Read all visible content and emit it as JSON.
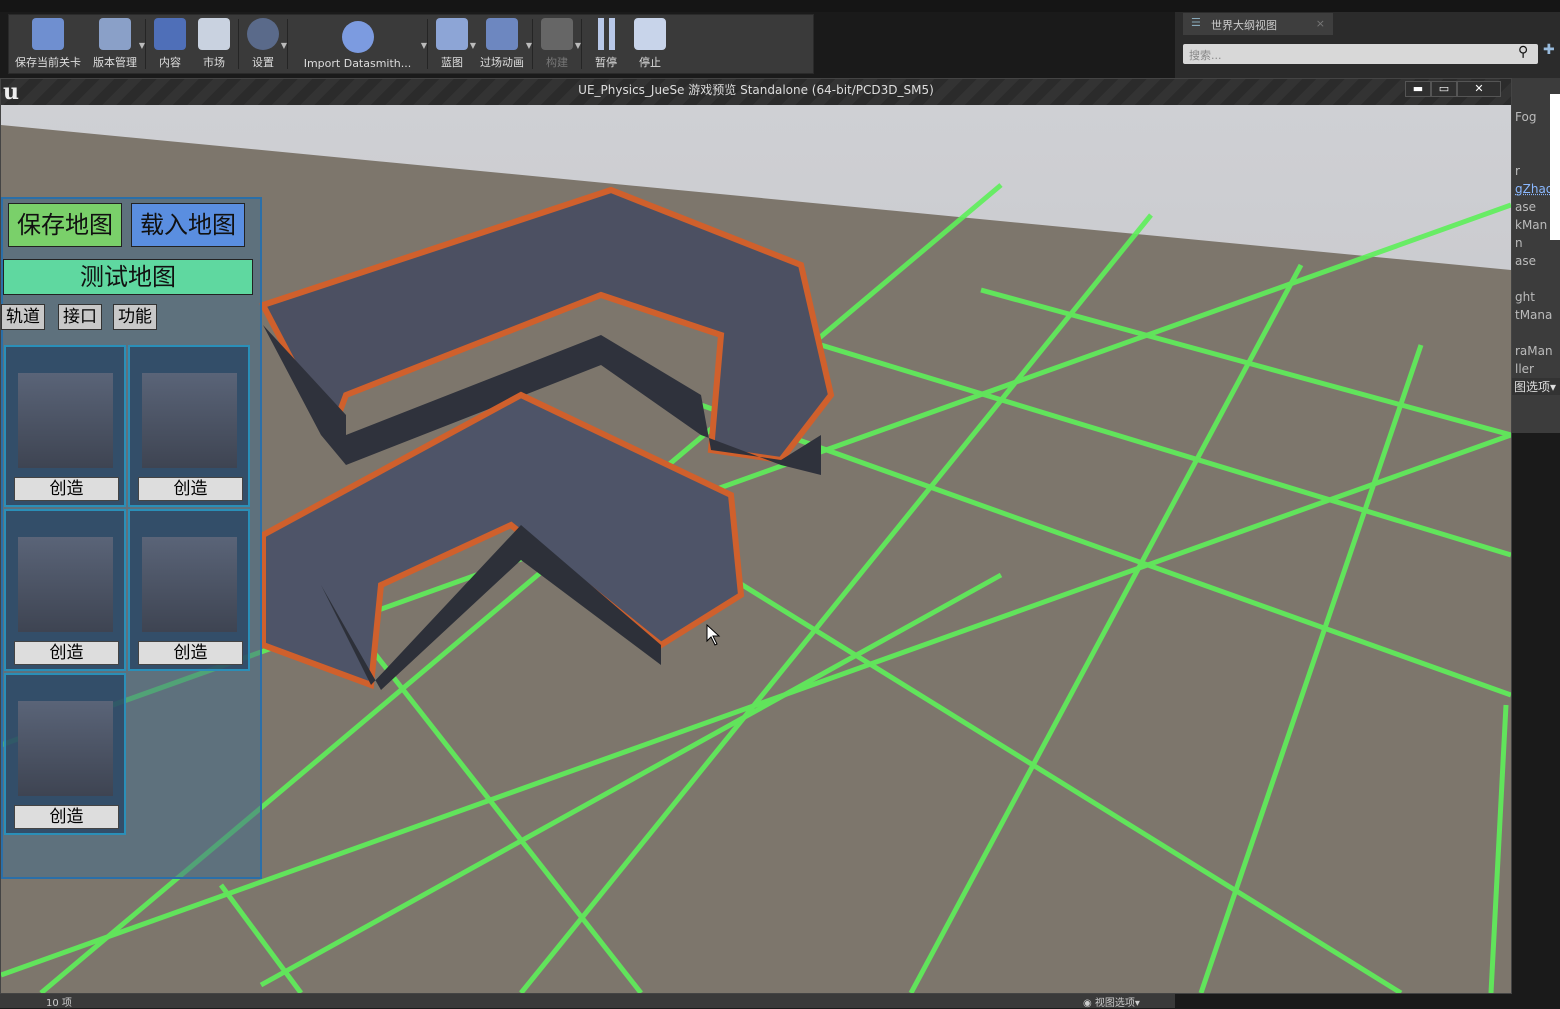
{
  "toolbar": {
    "items": [
      "保存当前关卡",
      "版本管理",
      "内容",
      "市场",
      "设置",
      "Import Datasmith...",
      "蓝图",
      "过场动画",
      "构建",
      "暂停",
      "停止"
    ]
  },
  "outliner": {
    "tab": "世界大纲视图",
    "search_placeholder": "搜索...",
    "items": [
      "Fog",
      "r",
      "gZhao",
      "ase",
      "kMan",
      "n",
      "ase",
      "ght",
      "tMana",
      "raMan",
      "ller"
    ],
    "view_options": "图选项"
  },
  "window": {
    "title": "UE_Physics_JueSe 游戏预览 Standalone (64-bit/PCD3D_SM5)",
    "min": "▬",
    "max": "▭",
    "close": "✕"
  },
  "panel": {
    "save_map": "保存地图",
    "load_map": "载入地图",
    "test_map": "测试地图",
    "tabs": [
      "轨道",
      "接口",
      "功能"
    ],
    "create": "创造"
  },
  "status": {
    "count": "10 项",
    "view_options": "视图选项"
  }
}
